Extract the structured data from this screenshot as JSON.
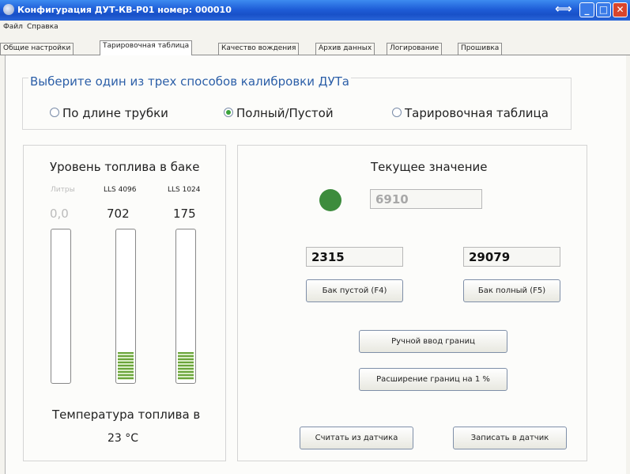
{
  "window": {
    "title": "Конфигурация ДУТ-КВ-Р01 номер: 000010",
    "buttons": {
      "resize": "⟺",
      "minimize": "_",
      "maximize": "□",
      "close": "✕"
    }
  },
  "menu": [
    "Файл",
    "Справка"
  ],
  "tabs": [
    {
      "label": "Общие настройки",
      "active": false
    },
    {
      "label": "Тарировочная таблица",
      "active": true
    },
    {
      "label": "Качество вождения",
      "active": false
    },
    {
      "label": "Архив данных",
      "active": false
    },
    {
      "label": "Логирование",
      "active": false
    },
    {
      "label": "Прошивка",
      "active": false
    }
  ],
  "calibration": {
    "title": "Выберите один из трех способов калибровки ДУТа",
    "options": [
      {
        "label": "По длине трубки",
        "selected": false
      },
      {
        "label": "Полный/Пустой",
        "selected": true
      },
      {
        "label": "Тарировочная таблица",
        "selected": false
      }
    ]
  },
  "fuel": {
    "title": "Уровень топлива в баке",
    "columns": [
      {
        "header": "Литры",
        "value": "0,0",
        "level": 0
      },
      {
        "header": "LLS 4096",
        "value": "702",
        "level": 0.19
      },
      {
        "header": "LLS 1024",
        "value": "175",
        "level": 0.19
      }
    ],
    "temp_label": "Температура топлива в",
    "temp_value": "23 °C"
  },
  "current": {
    "title": "Текущее значение",
    "value": "6910",
    "led_color": "#3d8c3d",
    "empty_value": "2315",
    "full_value": "29079",
    "empty_button": "Бак пустой (F4)",
    "full_button": "Бак полный (F5)",
    "manual_button": "Ручной ввод границ",
    "expand_button": "Расширение границ на 1 %",
    "read_button": "Считать из датчика",
    "write_button": "Записать в датчик"
  }
}
